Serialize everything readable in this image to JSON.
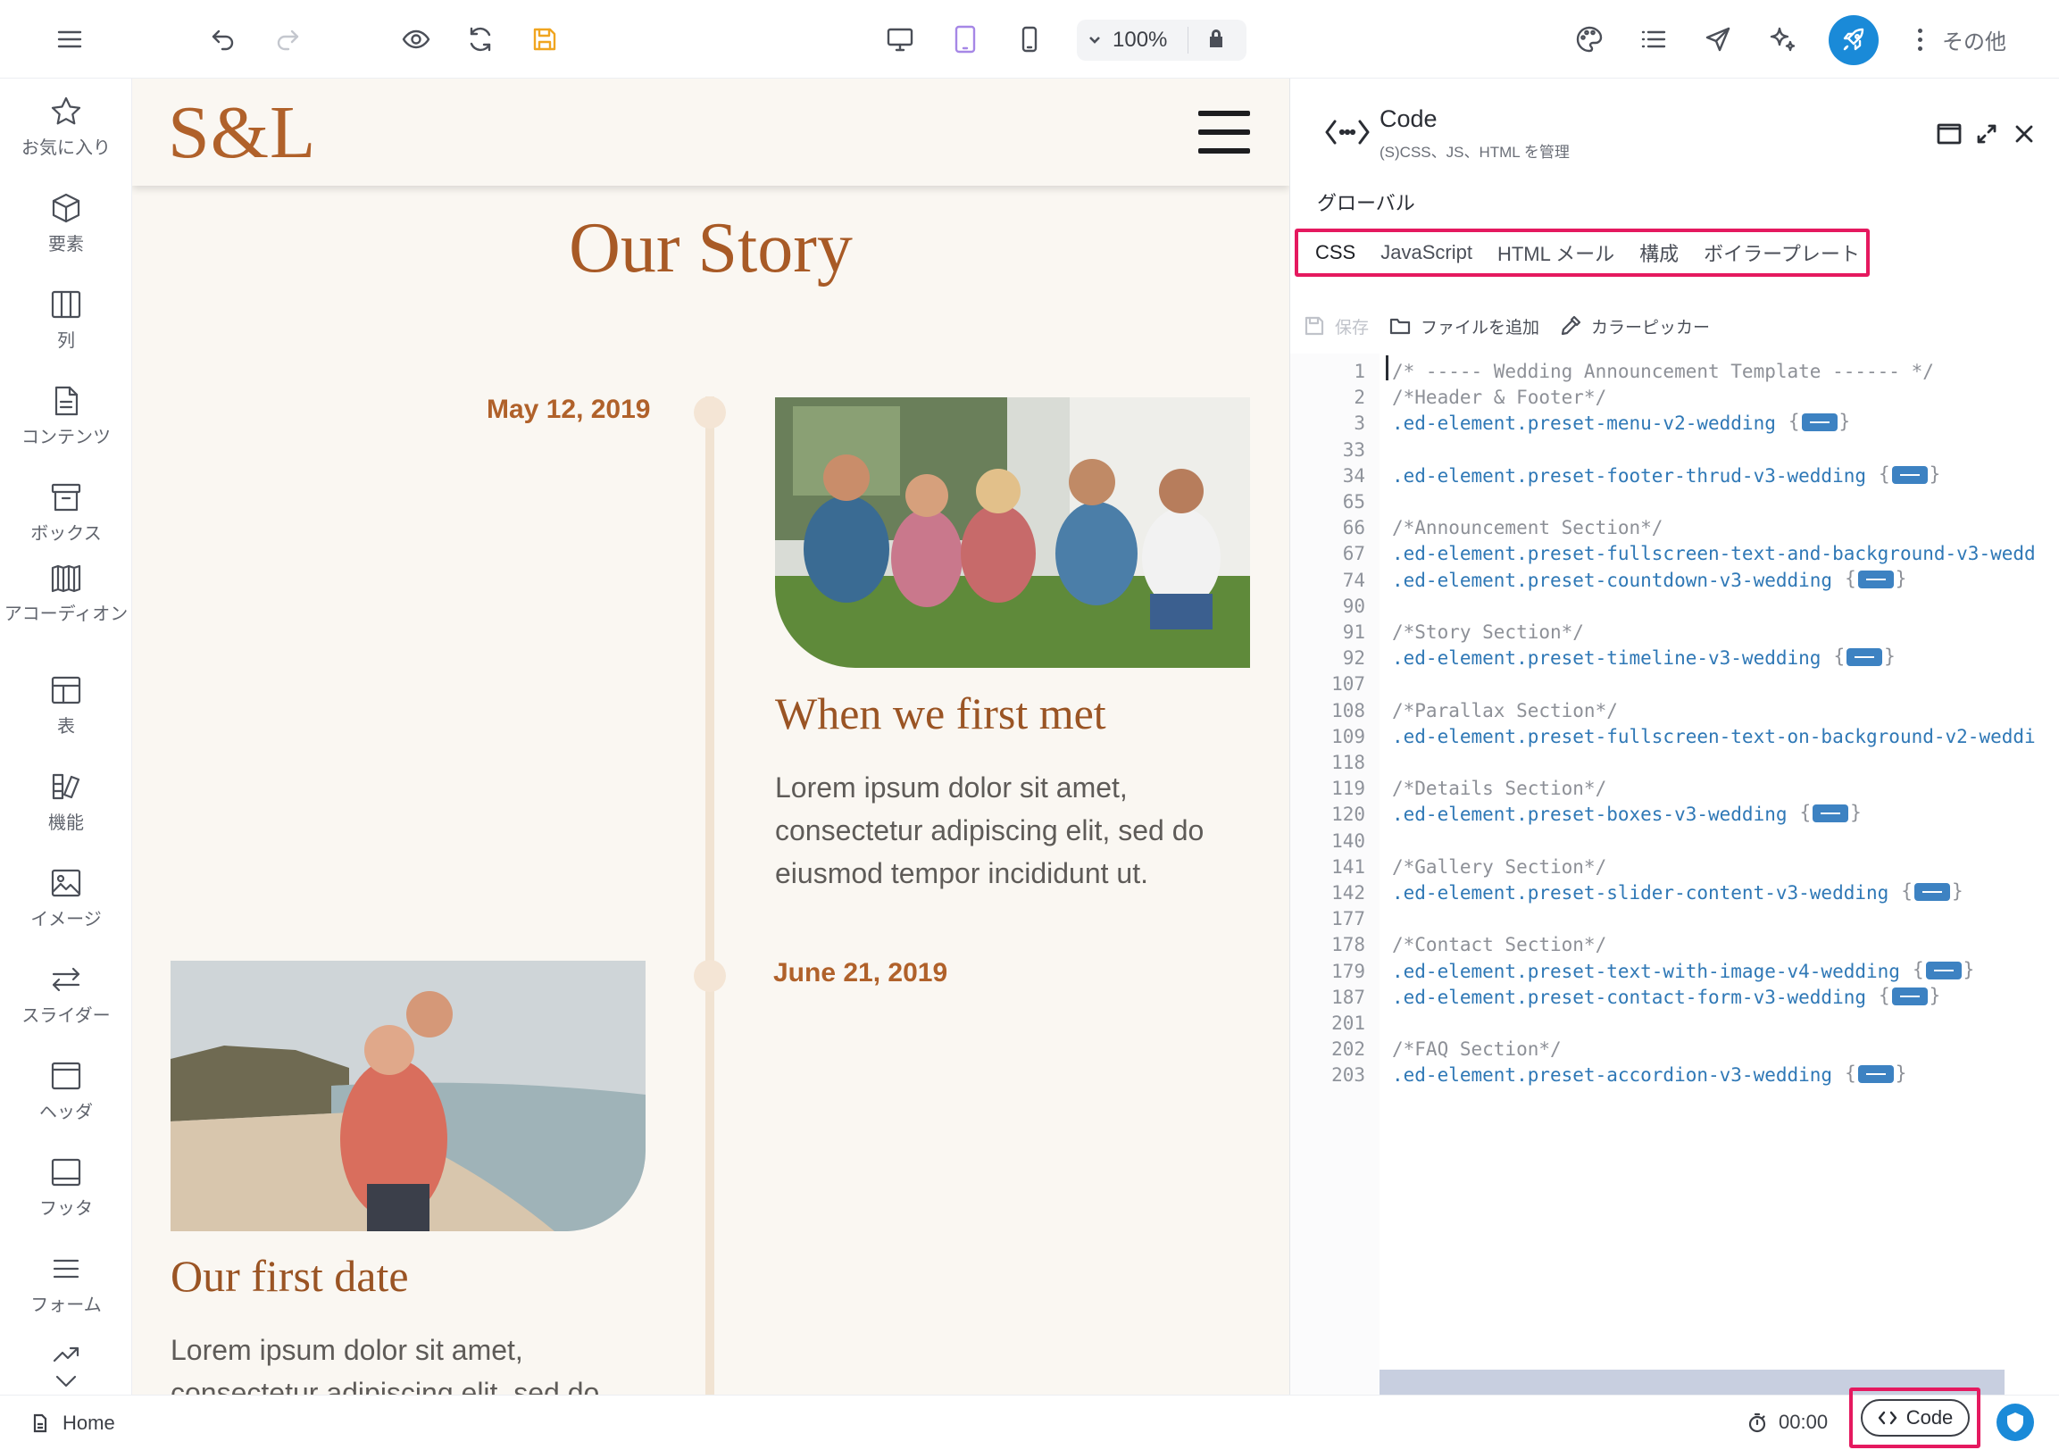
{
  "topbar": {
    "zoom_value": "100%",
    "more_label": "その他",
    "icons": [
      "menu-icon",
      "undo-icon",
      "redo-icon",
      "eye-icon",
      "refresh-icon",
      "save-icon",
      "desktop-icon",
      "tablet-icon",
      "mobile-icon",
      "chevron-down-icon",
      "lock-icon",
      "palette-icon",
      "list-icon",
      "send-icon",
      "sparkle-icon",
      "rocket-icon",
      "more-vertical-icon"
    ]
  },
  "sidebar": {
    "items": [
      {
        "label": "お気に入り",
        "icon": "star-icon"
      },
      {
        "label": "要素",
        "icon": "cube-icon"
      },
      {
        "label": "列",
        "icon": "columns-icon"
      },
      {
        "label": "コンテンツ",
        "icon": "document-icon"
      },
      {
        "label": "ボックス",
        "icon": "archive-icon"
      },
      {
        "label": "アコーディオン",
        "icon": "accordion-icon"
      },
      {
        "label": "表",
        "icon": "table-icon"
      },
      {
        "label": "機能",
        "icon": "features-icon"
      },
      {
        "label": "イメージ",
        "icon": "image-icon"
      },
      {
        "label": "スライダー",
        "icon": "slider-icon"
      },
      {
        "label": "ヘッダ",
        "icon": "header-icon"
      },
      {
        "label": "フッタ",
        "icon": "footer-icon"
      },
      {
        "label": "フォーム",
        "icon": "form-icon"
      }
    ]
  },
  "site": {
    "logo": "S&L",
    "section_title": "Our Story",
    "events": [
      {
        "date": "May 12, 2019",
        "heading": "When we first met",
        "text": "Lorem ipsum dolor sit amet, consectetur adipiscing elit, sed do eiusmod tempor incididunt ut."
      },
      {
        "date": "June 21, 2019",
        "heading": "Our first date",
        "text": "Lorem ipsum dolor sit amet, consectetur adipiscing elit, sed do"
      }
    ]
  },
  "code_panel": {
    "title": "Code",
    "subtitle": "(S)CSS、JS、HTML を管理",
    "scope": "グローバル",
    "tabs": [
      "CSS",
      "JavaScript",
      "HTML メール",
      "構成",
      "ボイラープレート"
    ],
    "active_tab": "CSS",
    "toolbar": {
      "save": "保存",
      "add_file": "ファイルを追加",
      "color_picker": "カラーピッカー"
    },
    "lines": [
      {
        "no": "1",
        "text": "/* ----- Wedding Announcement Template ------ */",
        "kind": "comment",
        "folded": false
      },
      {
        "no": "2",
        "text": "/*Header & Footer*/",
        "kind": "comment",
        "folded": false
      },
      {
        "no": "3",
        "text": ".ed-element.preset-menu-v2-wedding",
        "kind": "selector",
        "folded": true
      },
      {
        "no": "33",
        "text": "",
        "kind": "blank",
        "folded": false
      },
      {
        "no": "34",
        "text": ".ed-element.preset-footer-thrud-v3-wedding",
        "kind": "selector",
        "folded": true
      },
      {
        "no": "65",
        "text": "",
        "kind": "blank",
        "folded": false
      },
      {
        "no": "66",
        "text": "/*Announcement Section*/",
        "kind": "comment",
        "folded": false
      },
      {
        "no": "67",
        "text": ".ed-element.preset-fullscreen-text-and-background-v3-wedd",
        "kind": "selector",
        "folded": false
      },
      {
        "no": "74",
        "text": ".ed-element.preset-countdown-v3-wedding",
        "kind": "selector",
        "folded": true
      },
      {
        "no": "90",
        "text": "",
        "kind": "blank",
        "folded": false
      },
      {
        "no": "91",
        "text": "/*Story Section*/",
        "kind": "comment",
        "folded": false
      },
      {
        "no": "92",
        "text": ".ed-element.preset-timeline-v3-wedding",
        "kind": "selector",
        "folded": true
      },
      {
        "no": "107",
        "text": "",
        "kind": "blank",
        "folded": false
      },
      {
        "no": "108",
        "text": "/*Parallax Section*/",
        "kind": "comment",
        "folded": false
      },
      {
        "no": "109",
        "text": ".ed-element.preset-fullscreen-text-on-background-v2-weddi",
        "kind": "selector",
        "folded": false
      },
      {
        "no": "118",
        "text": "",
        "kind": "blank",
        "folded": false
      },
      {
        "no": "119",
        "text": "/*Details Section*/",
        "kind": "comment",
        "folded": false
      },
      {
        "no": "120",
        "text": ".ed-element.preset-boxes-v3-wedding",
        "kind": "selector",
        "folded": true
      },
      {
        "no": "140",
        "text": "",
        "kind": "blank",
        "folded": false
      },
      {
        "no": "141",
        "text": "/*Gallery Section*/",
        "kind": "comment",
        "folded": false
      },
      {
        "no": "142",
        "text": ".ed-element.preset-slider-content-v3-wedding",
        "kind": "selector",
        "folded": true
      },
      {
        "no": "177",
        "text": "",
        "kind": "blank",
        "folded": false
      },
      {
        "no": "178",
        "text": "/*Contact Section*/",
        "kind": "comment",
        "folded": false
      },
      {
        "no": "179",
        "text": ".ed-element.preset-text-with-image-v4-wedding",
        "kind": "selector",
        "folded": true
      },
      {
        "no": "187",
        "text": ".ed-element.preset-contact-form-v3-wedding",
        "kind": "selector",
        "folded": true
      },
      {
        "no": "201",
        "text": "",
        "kind": "blank",
        "folded": false
      },
      {
        "no": "202",
        "text": "/*FAQ Section*/",
        "kind": "comment",
        "folded": false
      },
      {
        "no": "203",
        "text": ".ed-element.preset-accordion-v3-wedding",
        "kind": "selector",
        "folded": true
      }
    ]
  },
  "statusbar": {
    "page": "Home",
    "timer": "00:00",
    "code_button": "Code"
  },
  "colors": {
    "accent_brand": "#b0612a",
    "highlight": "#e5195f",
    "primary_blue": "#1a8ad8",
    "selector_blue": "#2f78b6"
  }
}
